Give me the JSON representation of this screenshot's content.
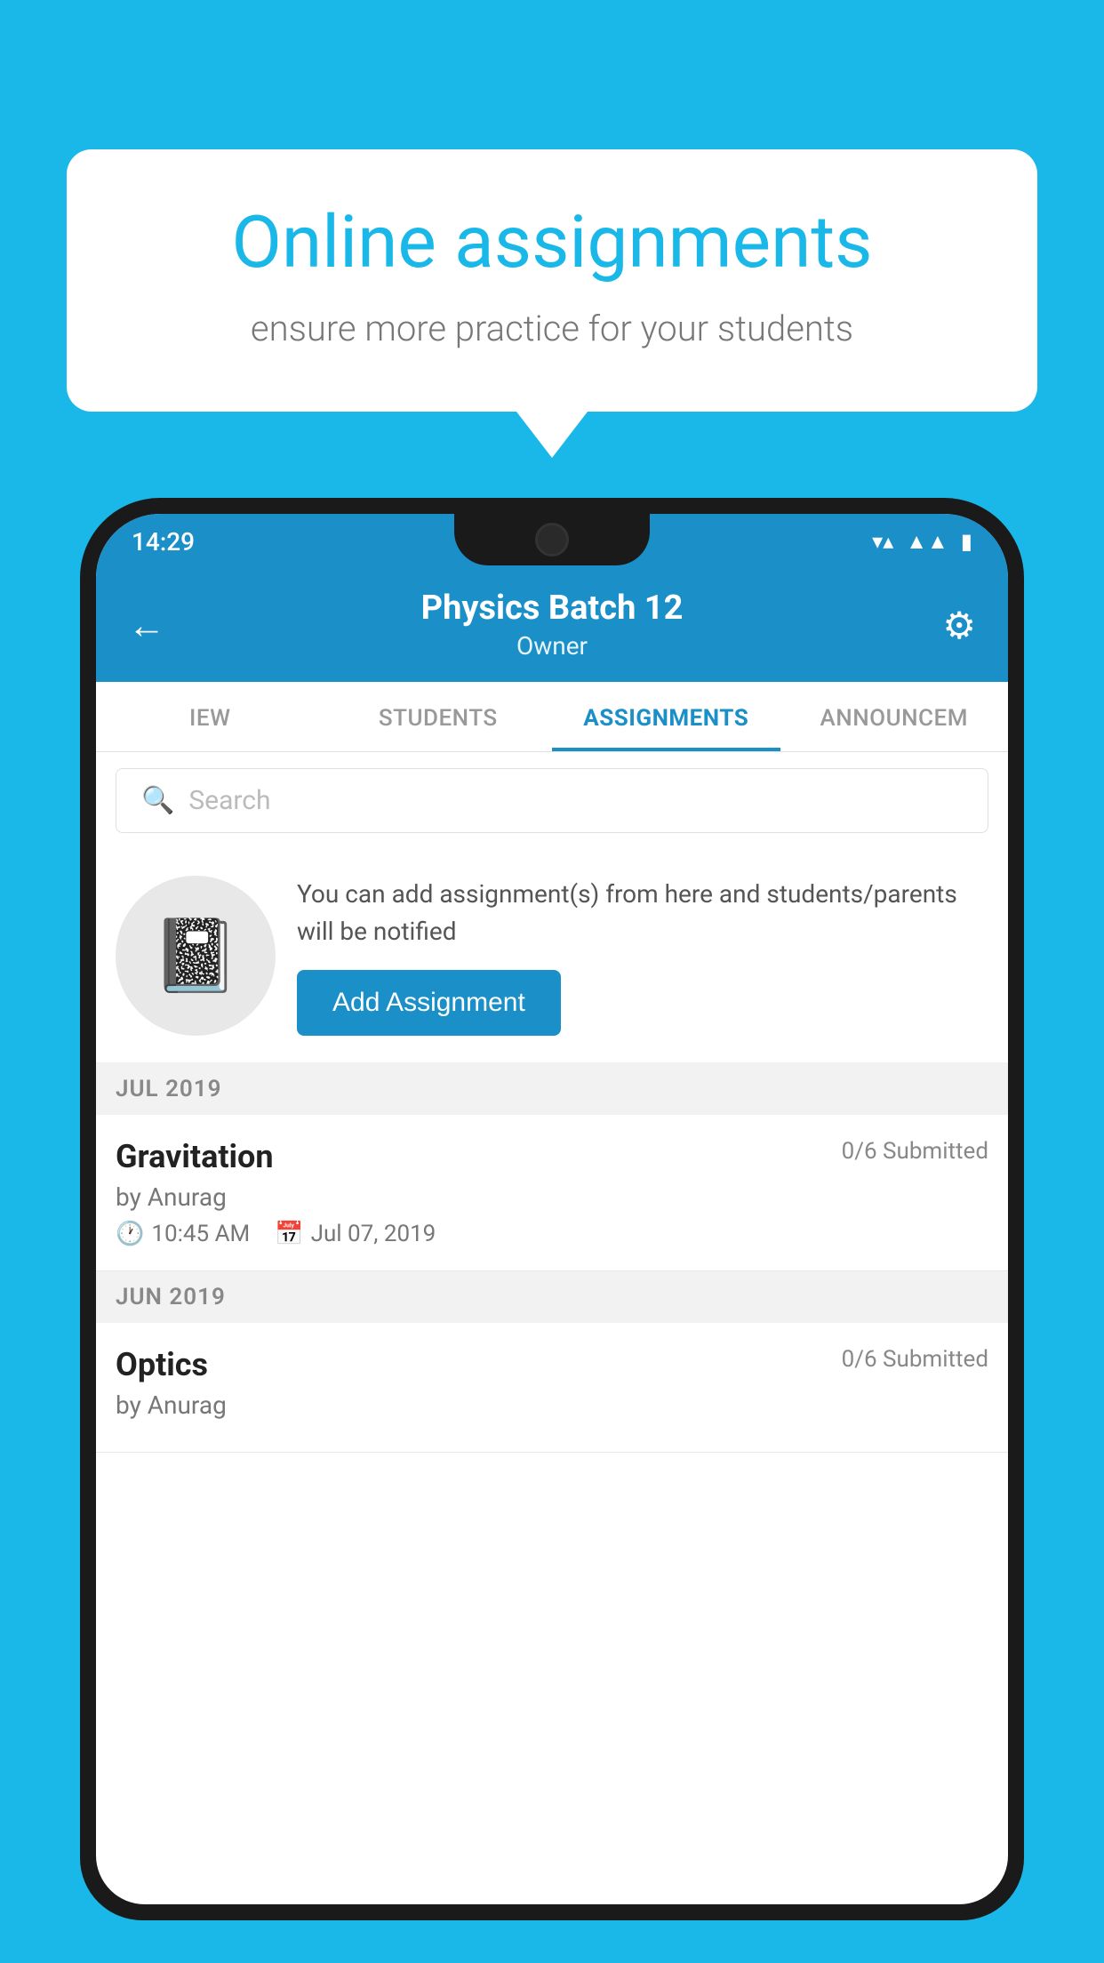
{
  "background_color": "#1ab8e8",
  "speech_bubble": {
    "title": "Online assignments",
    "subtitle": "ensure more practice for your students"
  },
  "status_bar": {
    "time": "14:29",
    "wifi": "▼",
    "signal": "▲",
    "battery": "▮"
  },
  "header": {
    "title": "Physics Batch 12",
    "subtitle": "Owner",
    "back_label": "←",
    "settings_label": "⚙"
  },
  "tabs": [
    {
      "label": "IEW",
      "active": false
    },
    {
      "label": "STUDENTS",
      "active": false
    },
    {
      "label": "ASSIGNMENTS",
      "active": true
    },
    {
      "label": "ANNOUNCEM",
      "active": false
    }
  ],
  "search": {
    "placeholder": "Search"
  },
  "promo": {
    "description": "You can add assignment(s) from here and students/parents will be notified",
    "button_label": "Add Assignment"
  },
  "month_sections": [
    {
      "month": "JUL 2019",
      "assignments": [
        {
          "name": "Gravitation",
          "submitted": "0/6 Submitted",
          "by": "by Anurag",
          "time": "10:45 AM",
          "date": "Jul 07, 2019"
        }
      ]
    },
    {
      "month": "JUN 2019",
      "assignments": [
        {
          "name": "Optics",
          "submitted": "0/6 Submitted",
          "by": "by Anurag",
          "time": "",
          "date": ""
        }
      ]
    }
  ]
}
